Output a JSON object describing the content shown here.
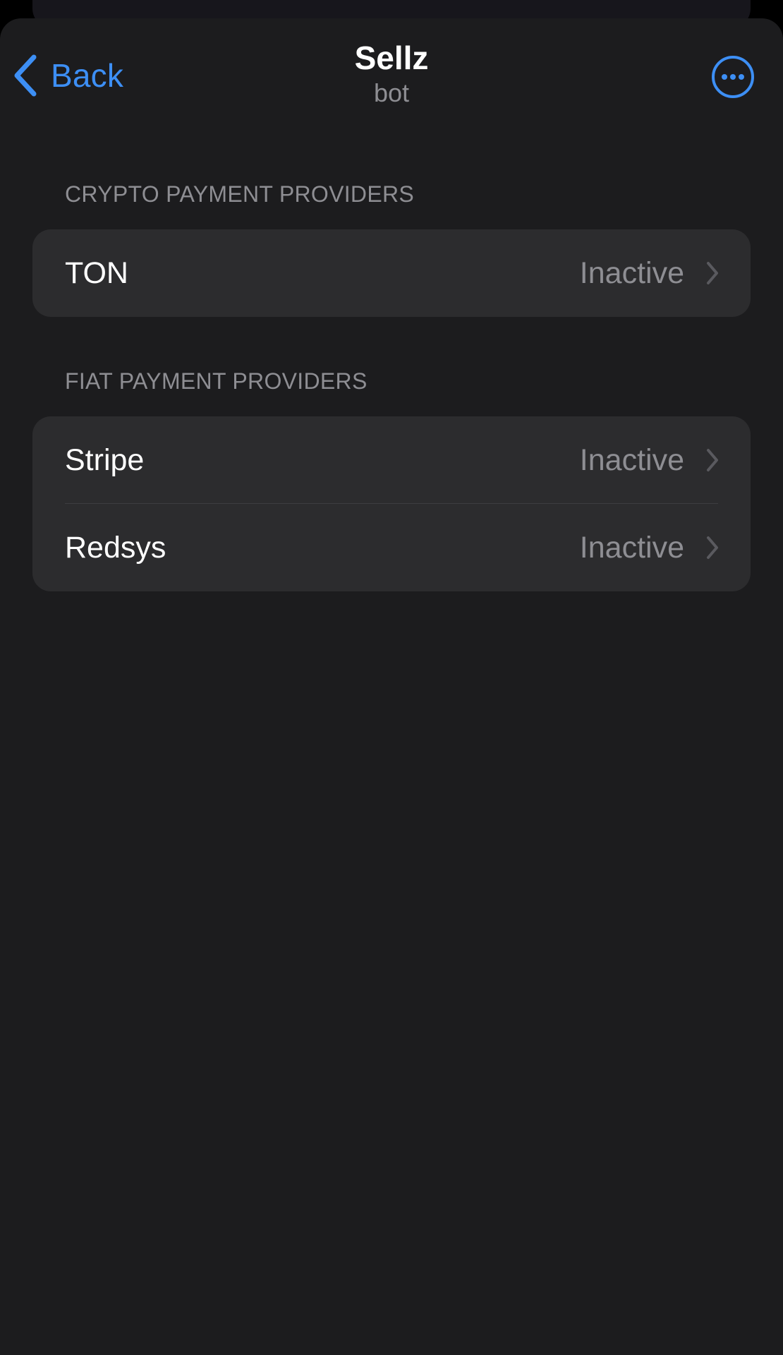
{
  "nav": {
    "back_label": "Back",
    "title": "Sellz",
    "subtitle": "bot",
    "more_icon": "ellipsis-circle-icon",
    "accent_color": "#3d8ff5"
  },
  "sections": [
    {
      "header": "CRYPTO PAYMENT PROVIDERS",
      "rows": [
        {
          "label": "TON",
          "status": "Inactive"
        }
      ]
    },
    {
      "header": "FIAT PAYMENT PROVIDERS",
      "rows": [
        {
          "label": "Stripe",
          "status": "Inactive"
        },
        {
          "label": "Redsys",
          "status": "Inactive"
        }
      ]
    }
  ],
  "colors": {
    "background": "#1c1c1e",
    "group_background": "#2c2c2e",
    "secondary_text": "#8e8e93",
    "primary_text": "#ffffff"
  }
}
